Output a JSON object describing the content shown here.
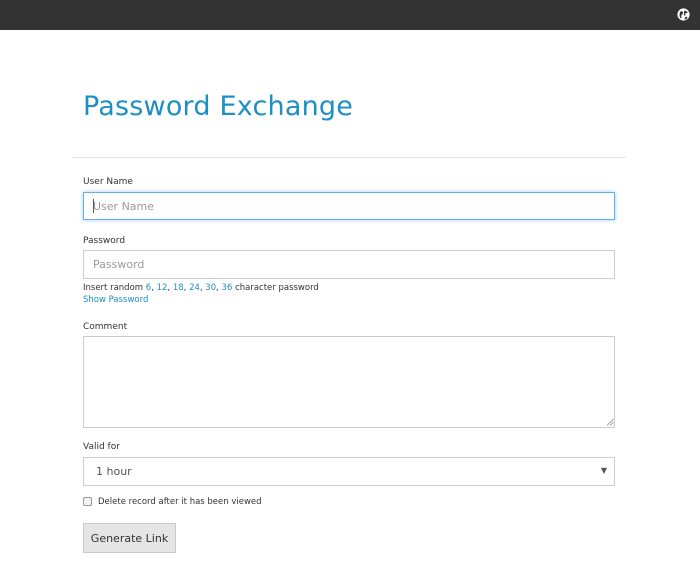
{
  "header": {
    "icon": "globe-icon"
  },
  "page": {
    "title": "Password Exchange"
  },
  "form": {
    "username": {
      "label": "User Name",
      "placeholder": "User Name",
      "value": ""
    },
    "password": {
      "label": "Password",
      "placeholder": "Password",
      "value": ""
    },
    "random": {
      "prefix": "Insert random",
      "lengths": [
        "6",
        "12",
        "18",
        "24",
        "30",
        "36"
      ],
      "suffix": "character password"
    },
    "show_password": "Show Password",
    "comment": {
      "label": "Comment",
      "value": ""
    },
    "valid_for": {
      "label": "Valid for",
      "selected": "1 hour"
    },
    "delete_after_view": {
      "label": "Delete record after it has been viewed",
      "checked": false
    },
    "submit_label": "Generate Link"
  },
  "colors": {
    "topbar": "#333333",
    "accent": "#1d8fc4",
    "focus_border": "#66afe9"
  }
}
